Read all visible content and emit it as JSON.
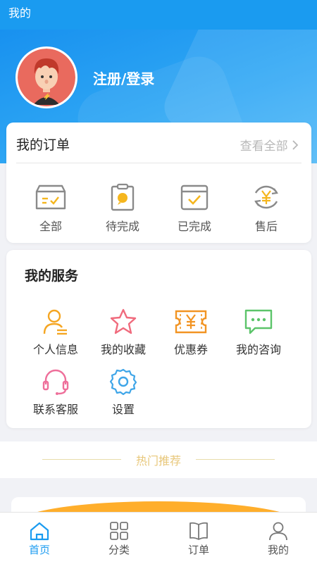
{
  "status_bar": {
    "title": "我的"
  },
  "profile": {
    "login_text": "注册/登录"
  },
  "orders": {
    "title": "我的订单",
    "view_all": "查看全部",
    "items": [
      {
        "label": "全部",
        "icon": "box-check-icon"
      },
      {
        "label": "待完成",
        "icon": "clipboard-chat-icon"
      },
      {
        "label": "已完成",
        "icon": "calendar-check-icon"
      },
      {
        "label": "售后",
        "icon": "yen-refresh-icon"
      }
    ]
  },
  "services": {
    "title": "我的服务",
    "items": [
      {
        "label": "个人信息",
        "icon": "user-icon",
        "color": "#f5a623"
      },
      {
        "label": "我的收藏",
        "icon": "star-icon",
        "color": "#f06b7d"
      },
      {
        "label": "优惠券",
        "icon": "coupon-icon",
        "color": "#f29423"
      },
      {
        "label": "我的咨询",
        "icon": "chat-icon",
        "color": "#5cc46a"
      },
      {
        "label": "联系客服",
        "icon": "headset-icon",
        "color": "#ee6f9a"
      },
      {
        "label": "设置",
        "icon": "gear-icon",
        "color": "#3ea5e8"
      }
    ]
  },
  "hot": {
    "title": "热门推荐"
  },
  "tabbar": {
    "items": [
      {
        "label": "首页",
        "icon": "home-icon",
        "active": true
      },
      {
        "label": "分类",
        "icon": "grid-icon",
        "active": false
      },
      {
        "label": "订单",
        "icon": "book-icon",
        "active": false
      },
      {
        "label": "我的",
        "icon": "person-icon",
        "active": false
      }
    ],
    "active_color": "#1a9bf0"
  }
}
